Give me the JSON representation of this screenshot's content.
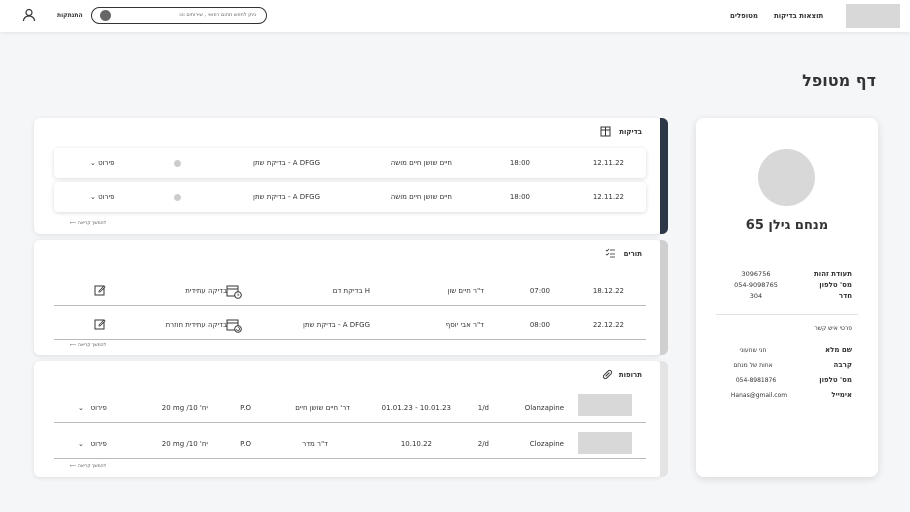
{
  "header": {
    "nav": [
      "תוצאות בדיקות",
      "מטופלים"
    ],
    "search_placeholder": "ניתן לחפש תחום רפואי , שירותים וכו",
    "logout": "התנתקות"
  },
  "page_title": "דף מטופל",
  "patient": {
    "name": "מנחם גילן 65",
    "fields": [
      {
        "label": "תעודת זהות",
        "value": "3096756"
      },
      {
        "label": "מס' טלפון",
        "value": "054-9098765"
      },
      {
        "label": "חדר",
        "value": "304"
      }
    ],
    "contact_title": "פרטי איש קשר",
    "contact": [
      {
        "label": "שם מלא",
        "value": "חני שחעוני"
      },
      {
        "label": "קרבה",
        "value": "אחות של מנחם"
      },
      {
        "label": "מס' טלפון",
        "value": "054-8981876"
      },
      {
        "label": "אימייל",
        "value": "Hanas@gmail.com"
      }
    ]
  },
  "tests": {
    "title": "בדיקות",
    "rows": [
      {
        "date": "12.11.22",
        "time": "18:00",
        "doctor": "חיים שושן חיים מושה",
        "test": "בדיקת שתן - A DFGG",
        "details": "פירוט"
      },
      {
        "date": "12.11.22",
        "time": "18:00",
        "doctor": "חיים שושן חיים מושה",
        "test": "בדיקת שתן - A DFGG",
        "details": "פירוט"
      }
    ],
    "more": "להמשך קריאה"
  },
  "queues": {
    "title": "תורים",
    "rows": [
      {
        "date": "18.12.22",
        "time": "07:00",
        "doctor": "ד\"ר חיים שון",
        "test": "בדיקת דם H",
        "type": "בדיקה עתידית"
      },
      {
        "date": "22.12.22",
        "time": "08:00",
        "doctor": "ד\"ר אבי יוסף",
        "test": "בדיקת שתן - A DFGG",
        "type": "בדיקה עתידית חוזרת"
      }
    ],
    "more": "להמשך קריאה"
  },
  "meds": {
    "title": "תרופות",
    "rows": [
      {
        "name": "Olanzapine",
        "freq": "1/d",
        "dates": "01.01.23 - 10.01.23",
        "doctor": "דר' חיים שושן חיים",
        "route": "P.O",
        "dose": "20 mg /יח' 10",
        "details": "פירוט"
      },
      {
        "name": "Clozapine",
        "freq": "2/d",
        "dates": "10.10.22",
        "doctor": "ד\"ר מדר",
        "route": "P.O",
        "dose": "20 mg /יח' 10",
        "details": "פירוט"
      }
    ],
    "more": "להמשך קריאה"
  }
}
